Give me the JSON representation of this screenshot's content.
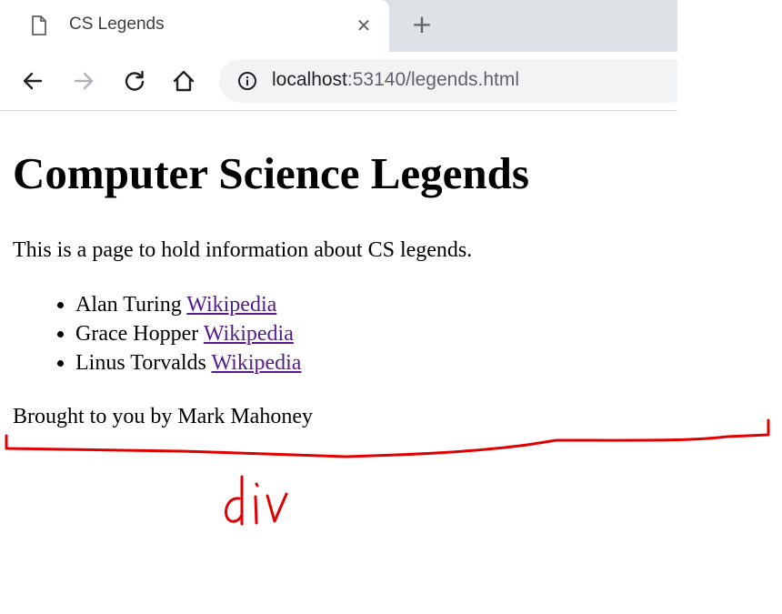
{
  "browser": {
    "tab": {
      "title": "CS Legends",
      "icon": "page-icon"
    },
    "url_host": "localhost",
    "url_rest": ":53140/legends.html",
    "icons": [
      "back-arrow-icon",
      "forward-arrow-icon",
      "reload-icon",
      "home-icon",
      "info-icon",
      "close-icon",
      "plus-icon"
    ]
  },
  "page": {
    "heading": "Computer Science Legends",
    "intro": "This is a page to hold information about CS legends.",
    "legends": [
      {
        "name": "Alan Turing",
        "link": "Wikipedia"
      },
      {
        "name": "Grace Hopper",
        "link": "Wikipedia"
      },
      {
        "name": "Linus Torvalds",
        "link": "Wikipedia"
      }
    ],
    "footer": "Brought to you by Mark Mahoney"
  },
  "annotation": {
    "label": "div",
    "color": "#e00000"
  },
  "colors": {
    "visited_link": "#551a8b",
    "tabbar_bg": "#dee1e6",
    "omnibox_bg": "#f1f3f4"
  }
}
